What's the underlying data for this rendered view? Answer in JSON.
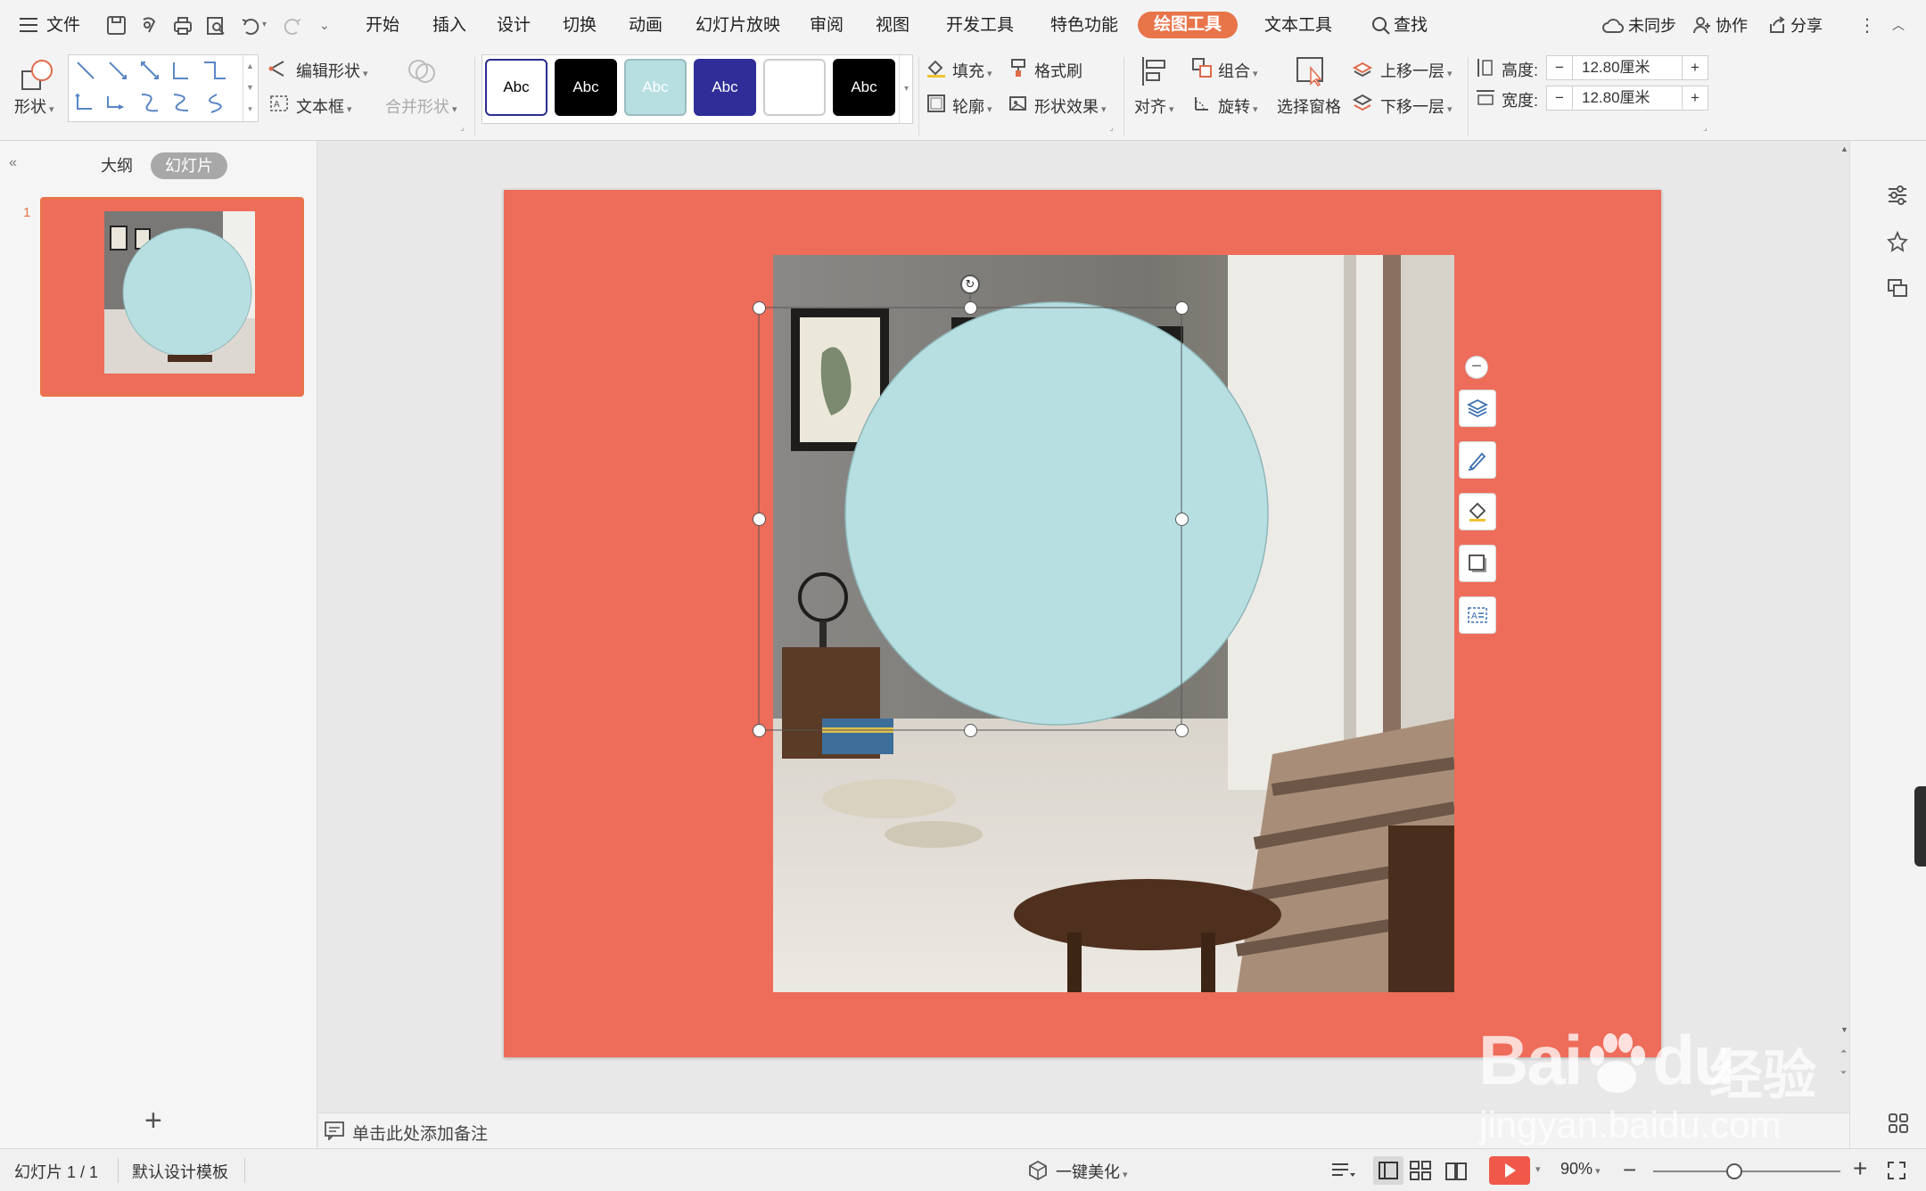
{
  "menubar": {
    "file_label": "文件",
    "tabs": [
      "开始",
      "插入",
      "设计",
      "切换",
      "动画",
      "幻灯片放映",
      "审阅",
      "视图",
      "开发工具",
      "特色功能",
      "绘图工具",
      "文本工具"
    ],
    "active_tab": "绘图工具",
    "search_label": "查找",
    "sync_label": "未同步",
    "collab_label": "协作",
    "share_label": "分享"
  },
  "ribbon": {
    "shape_label": "形状",
    "edit_shape_label": "编辑形状",
    "textbox_label": "文本框",
    "merge_shape_label": "合并形状",
    "style_samples": [
      {
        "label": "Abc",
        "bg": "#ffffff",
        "fg": "#000000",
        "border": "#2b2d8f"
      },
      {
        "label": "Abc",
        "bg": "#000000",
        "fg": "#ffffff",
        "border": "#000000"
      },
      {
        "label": "Abc",
        "bg": "#b7dfe2",
        "fg": "#ffffff",
        "border": "#9bbcc0"
      },
      {
        "label": "Abc",
        "bg": "#2f2d97",
        "fg": "#ffffff",
        "border": "#2f2d97"
      },
      {
        "label": "",
        "bg": "#ffffff",
        "fg": "#000000",
        "border": "#cccccc"
      },
      {
        "label": "Abc",
        "bg": "#000000",
        "fg": "#ffffff",
        "border": "#000000"
      }
    ],
    "fill_label": "填充",
    "format_painter_label": "格式刷",
    "outline_label": "轮廓",
    "shape_effect_label": "形状效果",
    "align_label": "对齐",
    "group_label": "组合",
    "rotate_label": "旋转",
    "selection_pane_label": "选择窗格",
    "bring_forward_label": "上移一层",
    "send_backward_label": "下移一层",
    "height_label": "高度:",
    "height_value": "12.80厘米",
    "width_label": "宽度:",
    "width_value": "12.80厘米"
  },
  "left_panel": {
    "outline_tab": "大纲",
    "slides_tab": "幻灯片",
    "slide_number": "1",
    "add_symbol": "+"
  },
  "notes": {
    "placeholder": "单击此处添加备注"
  },
  "statusbar": {
    "slide_info": "幻灯片 1 / 1",
    "template": "默认设计模板",
    "beautify_label": "一键美化",
    "zoom_label": "90%"
  },
  "watermark": {
    "brand": "Bai",
    "brand2": "du",
    "cn": "经验",
    "url": "jingyan.baidu.com"
  },
  "colors": {
    "accent": "#e8744a",
    "slide_bg": "#ee6c5a",
    "circle_fill": "#b7dfe2",
    "play_button": "#f0584a"
  }
}
